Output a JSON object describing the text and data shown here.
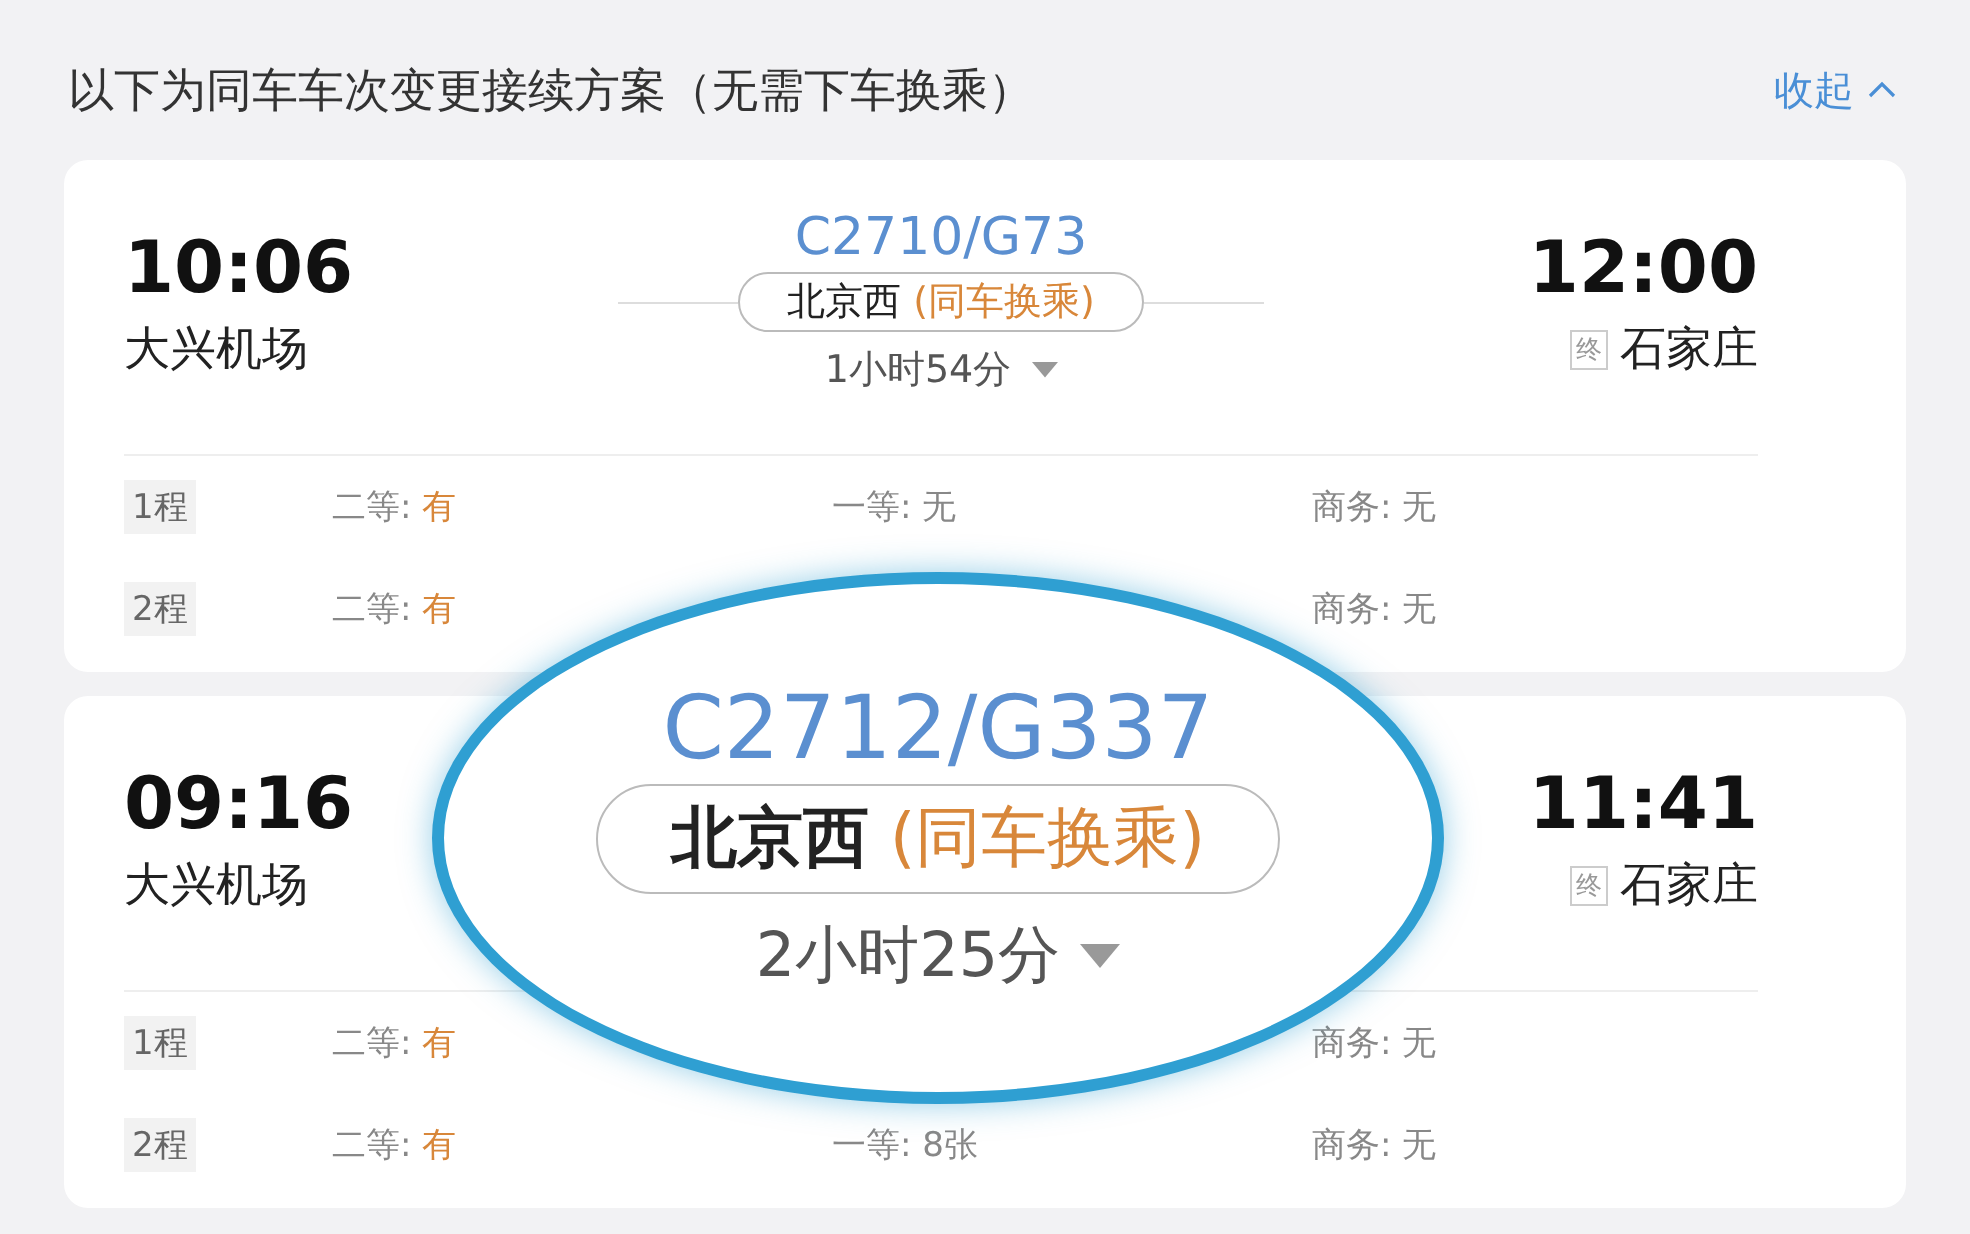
{
  "header": {
    "title": "以下为同车车次变更接续方案（无需下车换乘）",
    "collapse": "收起"
  },
  "cards": [
    {
      "depart_time": "10:06",
      "depart_station": "大兴机场",
      "arrive_time": "12:00",
      "terminal_badge": "终",
      "arrive_station": "石家庄",
      "center": {
        "train": "C2710/G73",
        "station": "北京西",
        "transfer": "(同车换乘)",
        "duration": "1小时54分"
      },
      "legs": [
        {
          "label": "1程",
          "second": {
            "name": "二等:",
            "value": "有",
            "available": true
          },
          "first": {
            "name": "一等:",
            "value": "无",
            "available": false
          },
          "business": {
            "name": "商务:",
            "value": "无",
            "available": false
          }
        },
        {
          "label": "2程",
          "second": {
            "name": "二等:",
            "value": "有",
            "available": true
          },
          "business": {
            "name": "商务:",
            "value": "无",
            "available": false
          }
        }
      ]
    },
    {
      "depart_time": "09:16",
      "depart_station": "大兴机场",
      "arrive_time": "11:41",
      "terminal_badge": "终",
      "arrive_station": "石家庄",
      "legs": [
        {
          "label": "1程",
          "second": {
            "name": "二等:",
            "value": "有",
            "available": true
          },
          "business": {
            "name": "商务:",
            "value": "无",
            "available": false
          }
        },
        {
          "label": "2程",
          "second": {
            "name": "二等:",
            "value": "有",
            "available": true
          },
          "first": {
            "name": "一等:",
            "value": "8张",
            "available": false
          },
          "business": {
            "name": "商务:",
            "value": "无",
            "available": false
          }
        }
      ],
      "magnifier": {
        "train": "C2712/G337",
        "station": "北京西",
        "transfer": "(同车换乘)",
        "duration": "2小时25分"
      }
    }
  ]
}
